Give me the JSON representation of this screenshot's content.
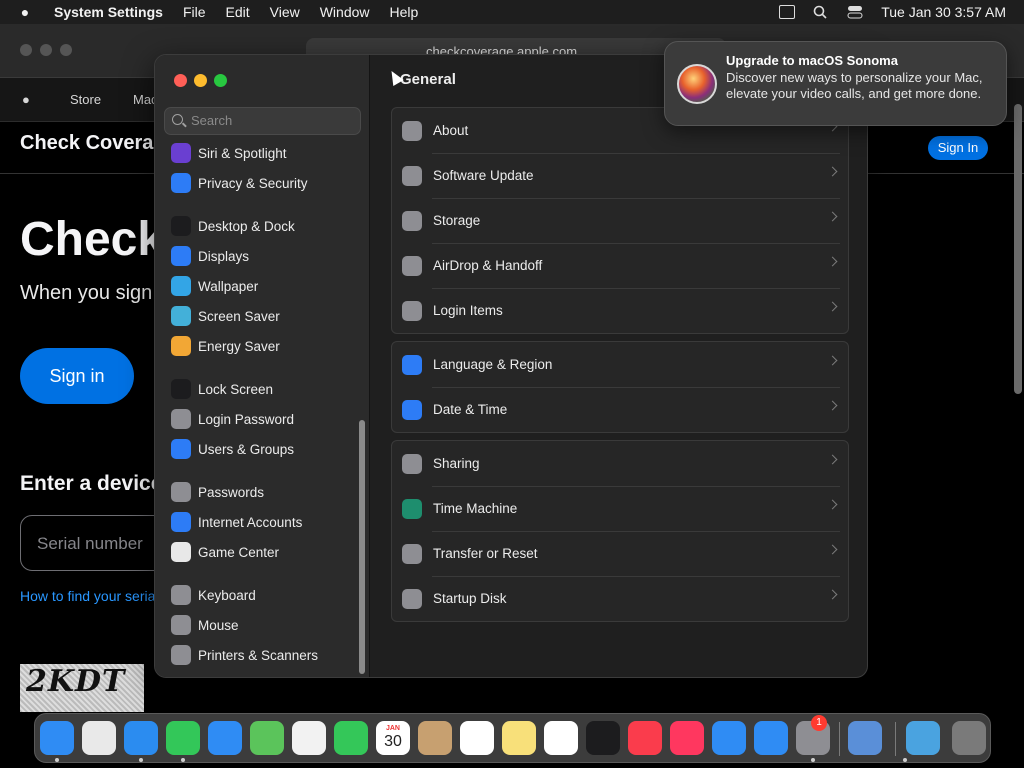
{
  "menubar": {
    "app": "System Settings",
    "menus": [
      "File",
      "Edit",
      "View",
      "Window",
      "Help"
    ],
    "clock": "Tue Jan 30  3:57 AM"
  },
  "browser": {
    "url": "checkcoverage.apple.com",
    "nav": [
      "Store",
      "Mac"
    ],
    "heading": "Check Covera",
    "signin_top": "Sign In",
    "big": "Check",
    "sub": "When you sign",
    "signin": "Sign in",
    "enter": "Enter a device",
    "serial_placeholder": "Serial number",
    "howto": "How to find your seria",
    "captcha": "2KDT"
  },
  "settings": {
    "search_placeholder": "Search",
    "title": "General",
    "sidebar": [
      {
        "label": "Siri & Spotlight",
        "icon": "siri-icon",
        "color": "#6a3fd1"
      },
      {
        "label": "Privacy & Security",
        "icon": "hand-icon",
        "color": "#2d7cf6"
      },
      {
        "label": "Desktop & Dock",
        "icon": "dock-icon",
        "color": "#1c1c1e"
      },
      {
        "label": "Displays",
        "icon": "sun-icon",
        "color": "#2d7cf6"
      },
      {
        "label": "Wallpaper",
        "icon": "flower-icon",
        "color": "#33a5e6"
      },
      {
        "label": "Screen Saver",
        "icon": "screensaver-icon",
        "color": "#43b0d9"
      },
      {
        "label": "Energy Saver",
        "icon": "battery-icon",
        "color": "#f2a735"
      },
      {
        "label": "Lock Screen",
        "icon": "lock-icon",
        "color": "#1c1c1e"
      },
      {
        "label": "Login Password",
        "icon": "lock-icon",
        "color": "#8e8e93"
      },
      {
        "label": "Users & Groups",
        "icon": "users-icon",
        "color": "#2d7cf6"
      },
      {
        "label": "Passwords",
        "icon": "key-icon",
        "color": "#8e8e93"
      },
      {
        "label": "Internet Accounts",
        "icon": "at-icon",
        "color": "#2d7cf6"
      },
      {
        "label": "Game Center",
        "icon": "gamecenter-icon",
        "color": "#e8e8e8"
      },
      {
        "label": "Keyboard",
        "icon": "keyboard-icon",
        "color": "#8e8e93"
      },
      {
        "label": "Mouse",
        "icon": "mouse-icon",
        "color": "#8e8e93"
      },
      {
        "label": "Printers & Scanners",
        "icon": "printer-icon",
        "color": "#8e8e93"
      }
    ],
    "groups": [
      [
        {
          "label": "About",
          "icon": "about-icon",
          "color": "#8e8e93"
        },
        {
          "label": "Software Update",
          "icon": "gear-icon",
          "color": "#8e8e93"
        },
        {
          "label": "Storage",
          "icon": "storage-icon",
          "color": "#8e8e93"
        },
        {
          "label": "AirDrop & Handoff",
          "icon": "airdrop-icon",
          "color": "#8e8e93"
        },
        {
          "label": "Login Items",
          "icon": "list-icon",
          "color": "#8e8e93"
        }
      ],
      [
        {
          "label": "Language & Region",
          "icon": "globe-icon",
          "color": "#2d7cf6"
        },
        {
          "label": "Date & Time",
          "icon": "calendar-icon",
          "color": "#2d7cf6"
        }
      ],
      [
        {
          "label": "Sharing",
          "icon": "sharing-icon",
          "color": "#8e8e93"
        },
        {
          "label": "Time Machine",
          "icon": "clock-icon",
          "color": "#1e8e6e"
        },
        {
          "label": "Transfer or Reset",
          "icon": "reset-icon",
          "color": "#8e8e93"
        },
        {
          "label": "Startup Disk",
          "icon": "disk-icon",
          "color": "#8e8e93"
        }
      ]
    ]
  },
  "notification": {
    "title": "Upgrade to macOS Sonoma",
    "body": "Discover new ways to personalize your Mac, elevate your video calls, and get more done."
  },
  "dock": {
    "calendar_month": "JAN",
    "calendar_day": "30",
    "badge": "1",
    "apps": [
      "finder-icon",
      "launchpad-icon",
      "safari-icon",
      "messages-icon",
      "mail-icon",
      "maps-icon",
      "photos-icon",
      "facetime-icon",
      "calendar-icon",
      "contacts-icon",
      "reminders-icon",
      "notes-icon",
      "freeform-icon",
      "tv-icon",
      "music-icon",
      "news-icon",
      "keynote-icon",
      "appstore-icon",
      "system-settings-icon",
      "finder2-icon",
      "downloads-icon",
      "trash-icon"
    ]
  }
}
